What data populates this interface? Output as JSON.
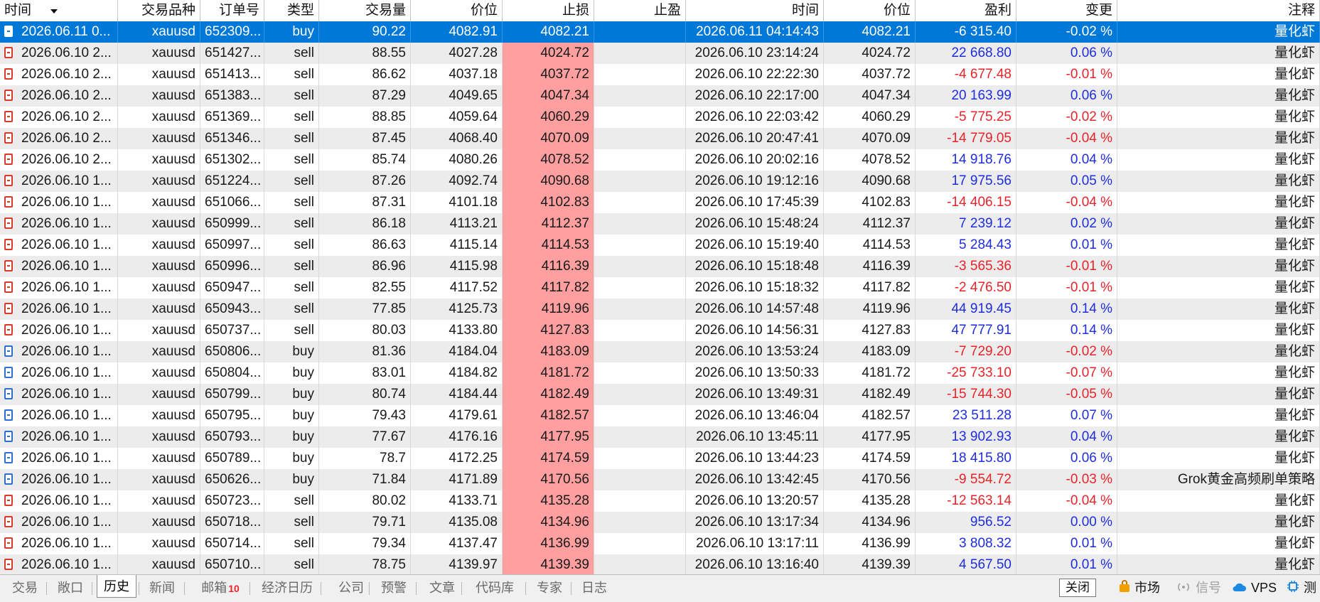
{
  "columns": [
    "时间",
    "交易品种",
    "订单号",
    "类型",
    "交易量",
    "价位",
    "止损",
    "止盈",
    "时间",
    "价位",
    "盈利",
    "变更",
    "注释"
  ],
  "rows": [
    {
      "open_time": "2026.06.11 0...",
      "symbol": "xauusd",
      "order": "652309...",
      "type": "buy",
      "volume": "90.22",
      "price": "4082.91",
      "sl": "4082.21",
      "tp": "",
      "close_time": "2026.06.11 04:14:43",
      "close_price": "4082.21",
      "profit": "-6 315.40",
      "change": "-0.02 %",
      "comment": "量化虾",
      "selected": true,
      "sl_hit": false
    },
    {
      "open_time": "2026.06.10 2...",
      "symbol": "xauusd",
      "order": "651427...",
      "type": "sell",
      "volume": "88.55",
      "price": "4027.28",
      "sl": "4024.72",
      "tp": "",
      "close_time": "2026.06.10 23:14:24",
      "close_price": "4024.72",
      "profit": "22 668.80",
      "change": "0.06 %",
      "comment": "量化虾",
      "selected": false,
      "sl_hit": true
    },
    {
      "open_time": "2026.06.10 2...",
      "symbol": "xauusd",
      "order": "651413...",
      "type": "sell",
      "volume": "86.62",
      "price": "4037.18",
      "sl": "4037.72",
      "tp": "",
      "close_time": "2026.06.10 22:22:30",
      "close_price": "4037.72",
      "profit": "-4 677.48",
      "change": "-0.01 %",
      "comment": "量化虾",
      "selected": false,
      "sl_hit": true
    },
    {
      "open_time": "2026.06.10 2...",
      "symbol": "xauusd",
      "order": "651383...",
      "type": "sell",
      "volume": "87.29",
      "price": "4049.65",
      "sl": "4047.34",
      "tp": "",
      "close_time": "2026.06.10 22:17:00",
      "close_price": "4047.34",
      "profit": "20 163.99",
      "change": "0.06 %",
      "comment": "量化虾",
      "selected": false,
      "sl_hit": true
    },
    {
      "open_time": "2026.06.10 2...",
      "symbol": "xauusd",
      "order": "651369...",
      "type": "sell",
      "volume": "88.85",
      "price": "4059.64",
      "sl": "4060.29",
      "tp": "",
      "close_time": "2026.06.10 22:03:42",
      "close_price": "4060.29",
      "profit": "-5 775.25",
      "change": "-0.02 %",
      "comment": "量化虾",
      "selected": false,
      "sl_hit": true
    },
    {
      "open_time": "2026.06.10 2...",
      "symbol": "xauusd",
      "order": "651346...",
      "type": "sell",
      "volume": "87.45",
      "price": "4068.40",
      "sl": "4070.09",
      "tp": "",
      "close_time": "2026.06.10 20:47:41",
      "close_price": "4070.09",
      "profit": "-14 779.05",
      "change": "-0.04 %",
      "comment": "量化虾",
      "selected": false,
      "sl_hit": true
    },
    {
      "open_time": "2026.06.10 2...",
      "symbol": "xauusd",
      "order": "651302...",
      "type": "sell",
      "volume": "85.74",
      "price": "4080.26",
      "sl": "4078.52",
      "tp": "",
      "close_time": "2026.06.10 20:02:16",
      "close_price": "4078.52",
      "profit": "14 918.76",
      "change": "0.04 %",
      "comment": "量化虾",
      "selected": false,
      "sl_hit": true
    },
    {
      "open_time": "2026.06.10 1...",
      "symbol": "xauusd",
      "order": "651224...",
      "type": "sell",
      "volume": "87.26",
      "price": "4092.74",
      "sl": "4090.68",
      "tp": "",
      "close_time": "2026.06.10 19:12:16",
      "close_price": "4090.68",
      "profit": "17 975.56",
      "change": "0.05 %",
      "comment": "量化虾",
      "selected": false,
      "sl_hit": true
    },
    {
      "open_time": "2026.06.10 1...",
      "symbol": "xauusd",
      "order": "651066...",
      "type": "sell",
      "volume": "87.31",
      "price": "4101.18",
      "sl": "4102.83",
      "tp": "",
      "close_time": "2026.06.10 17:45:39",
      "close_price": "4102.83",
      "profit": "-14 406.15",
      "change": "-0.04 %",
      "comment": "量化虾",
      "selected": false,
      "sl_hit": true
    },
    {
      "open_time": "2026.06.10 1...",
      "symbol": "xauusd",
      "order": "650999...",
      "type": "sell",
      "volume": "86.18",
      "price": "4113.21",
      "sl": "4112.37",
      "tp": "",
      "close_time": "2026.06.10 15:48:24",
      "close_price": "4112.37",
      "profit": "7 239.12",
      "change": "0.02 %",
      "comment": "量化虾",
      "selected": false,
      "sl_hit": true
    },
    {
      "open_time": "2026.06.10 1...",
      "symbol": "xauusd",
      "order": "650997...",
      "type": "sell",
      "volume": "86.63",
      "price": "4115.14",
      "sl": "4114.53",
      "tp": "",
      "close_time": "2026.06.10 15:19:40",
      "close_price": "4114.53",
      "profit": "5 284.43",
      "change": "0.01 %",
      "comment": "量化虾",
      "selected": false,
      "sl_hit": true
    },
    {
      "open_time": "2026.06.10 1...",
      "symbol": "xauusd",
      "order": "650996...",
      "type": "sell",
      "volume": "86.96",
      "price": "4115.98",
      "sl": "4116.39",
      "tp": "",
      "close_time": "2026.06.10 15:18:48",
      "close_price": "4116.39",
      "profit": "-3 565.36",
      "change": "-0.01 %",
      "comment": "量化虾",
      "selected": false,
      "sl_hit": true
    },
    {
      "open_time": "2026.06.10 1...",
      "symbol": "xauusd",
      "order": "650947...",
      "type": "sell",
      "volume": "82.55",
      "price": "4117.52",
      "sl": "4117.82",
      "tp": "",
      "close_time": "2026.06.10 15:18:32",
      "close_price": "4117.82",
      "profit": "-2 476.50",
      "change": "-0.01 %",
      "comment": "量化虾",
      "selected": false,
      "sl_hit": true
    },
    {
      "open_time": "2026.06.10 1...",
      "symbol": "xauusd",
      "order": "650943...",
      "type": "sell",
      "volume": "77.85",
      "price": "4125.73",
      "sl": "4119.96",
      "tp": "",
      "close_time": "2026.06.10 14:57:48",
      "close_price": "4119.96",
      "profit": "44 919.45",
      "change": "0.14 %",
      "comment": "量化虾",
      "selected": false,
      "sl_hit": true
    },
    {
      "open_time": "2026.06.10 1...",
      "symbol": "xauusd",
      "order": "650737...",
      "type": "sell",
      "volume": "80.03",
      "price": "4133.80",
      "sl": "4127.83",
      "tp": "",
      "close_time": "2026.06.10 14:56:31",
      "close_price": "4127.83",
      "profit": "47 777.91",
      "change": "0.14 %",
      "comment": "量化虾",
      "selected": false,
      "sl_hit": true
    },
    {
      "open_time": "2026.06.10 1...",
      "symbol": "xauusd",
      "order": "650806...",
      "type": "buy",
      "volume": "81.36",
      "price": "4184.04",
      "sl": "4183.09",
      "tp": "",
      "close_time": "2026.06.10 13:53:24",
      "close_price": "4183.09",
      "profit": "-7 729.20",
      "change": "-0.02 %",
      "comment": "量化虾",
      "selected": false,
      "sl_hit": true
    },
    {
      "open_time": "2026.06.10 1...",
      "symbol": "xauusd",
      "order": "650804...",
      "type": "buy",
      "volume": "83.01",
      "price": "4184.82",
      "sl": "4181.72",
      "tp": "",
      "close_time": "2026.06.10 13:50:33",
      "close_price": "4181.72",
      "profit": "-25 733.10",
      "change": "-0.07 %",
      "comment": "量化虾",
      "selected": false,
      "sl_hit": true
    },
    {
      "open_time": "2026.06.10 1...",
      "symbol": "xauusd",
      "order": "650799...",
      "type": "buy",
      "volume": "80.74",
      "price": "4184.44",
      "sl": "4182.49",
      "tp": "",
      "close_time": "2026.06.10 13:49:31",
      "close_price": "4182.49",
      "profit": "-15 744.30",
      "change": "-0.05 %",
      "comment": "量化虾",
      "selected": false,
      "sl_hit": true
    },
    {
      "open_time": "2026.06.10 1...",
      "symbol": "xauusd",
      "order": "650795...",
      "type": "buy",
      "volume": "79.43",
      "price": "4179.61",
      "sl": "4182.57",
      "tp": "",
      "close_time": "2026.06.10 13:46:04",
      "close_price": "4182.57",
      "profit": "23 511.28",
      "change": "0.07 %",
      "comment": "量化虾",
      "selected": false,
      "sl_hit": true
    },
    {
      "open_time": "2026.06.10 1...",
      "symbol": "xauusd",
      "order": "650793...",
      "type": "buy",
      "volume": "77.67",
      "price": "4176.16",
      "sl": "4177.95",
      "tp": "",
      "close_time": "2026.06.10 13:45:11",
      "close_price": "4177.95",
      "profit": "13 902.93",
      "change": "0.04 %",
      "comment": "量化虾",
      "selected": false,
      "sl_hit": true
    },
    {
      "open_time": "2026.06.10 1...",
      "symbol": "xauusd",
      "order": "650789...",
      "type": "buy",
      "volume": "78.7",
      "price": "4172.25",
      "sl": "4174.59",
      "tp": "",
      "close_time": "2026.06.10 13:44:23",
      "close_price": "4174.59",
      "profit": "18 415.80",
      "change": "0.06 %",
      "comment": "量化虾",
      "selected": false,
      "sl_hit": true
    },
    {
      "open_time": "2026.06.10 1...",
      "symbol": "xauusd",
      "order": "650626...",
      "type": "buy",
      "volume": "71.84",
      "price": "4171.89",
      "sl": "4170.56",
      "tp": "",
      "close_time": "2026.06.10 13:42:45",
      "close_price": "4170.56",
      "profit": "-9 554.72",
      "change": "-0.03 %",
      "comment": "Grok黄金高频刷单策略",
      "selected": false,
      "sl_hit": true
    },
    {
      "open_time": "2026.06.10 1...",
      "symbol": "xauusd",
      "order": "650723...",
      "type": "sell",
      "volume": "80.02",
      "price": "4133.71",
      "sl": "4135.28",
      "tp": "",
      "close_time": "2026.06.10 13:20:57",
      "close_price": "4135.28",
      "profit": "-12 563.14",
      "change": "-0.04 %",
      "comment": "量化虾",
      "selected": false,
      "sl_hit": true
    },
    {
      "open_time": "2026.06.10 1...",
      "symbol": "xauusd",
      "order": "650718...",
      "type": "sell",
      "volume": "79.71",
      "price": "4135.08",
      "sl": "4134.96",
      "tp": "",
      "close_time": "2026.06.10 13:17:34",
      "close_price": "4134.96",
      "profit": "956.52",
      "change": "0.00 %",
      "comment": "量化虾",
      "selected": false,
      "sl_hit": true
    },
    {
      "open_time": "2026.06.10 1...",
      "symbol": "xauusd",
      "order": "650714...",
      "type": "sell",
      "volume": "79.34",
      "price": "4137.47",
      "sl": "4136.99",
      "tp": "",
      "close_time": "2026.06.10 13:17:11",
      "close_price": "4136.99",
      "profit": "3 808.32",
      "change": "0.01 %",
      "comment": "量化虾",
      "selected": false,
      "sl_hit": true
    },
    {
      "open_time": "2026.06.10 1...",
      "symbol": "xauusd",
      "order": "650710...",
      "type": "sell",
      "volume": "78.75",
      "price": "4139.97",
      "sl": "4139.39",
      "tp": "",
      "close_time": "2026.06.10 13:16:40",
      "close_price": "4139.39",
      "profit": "4 567.50",
      "change": "0.01 %",
      "comment": "量化虾",
      "selected": false,
      "sl_hit": true
    }
  ],
  "tabs": [
    {
      "label": "交易",
      "active": false
    },
    {
      "label": "敞口",
      "active": false
    },
    {
      "label": "历史",
      "active": true
    },
    {
      "label": "新闻",
      "active": false
    },
    {
      "label": "邮箱",
      "active": false,
      "badge": "10"
    },
    {
      "label": "经济日历",
      "active": false
    },
    {
      "label": "公司",
      "active": false
    },
    {
      "label": "预警",
      "active": false
    },
    {
      "label": "文章",
      "active": false
    },
    {
      "label": "代码库",
      "active": false
    },
    {
      "label": "专家",
      "active": false
    },
    {
      "label": "日志",
      "active": false
    }
  ],
  "status": {
    "tooltip": "关闭",
    "market": "市场",
    "signals": "信号",
    "vps": "VPS",
    "tester": "测"
  },
  "colors": {
    "selected_row": "#0078d7",
    "stop_loss_hit": "#ff9f9f",
    "profit_positive": "#1f2de0",
    "profit_negative": "#e8232a",
    "alt_row": "#ececec"
  },
  "icons": {
    "sort": "sort-desc-icon",
    "buy": "buy-trade-icon",
    "sell": "sell-trade-icon",
    "market": "shopping-bag-icon",
    "signals": "signal-broadcast-icon",
    "vps": "cloud-icon",
    "tester": "cpu-chip-icon"
  }
}
